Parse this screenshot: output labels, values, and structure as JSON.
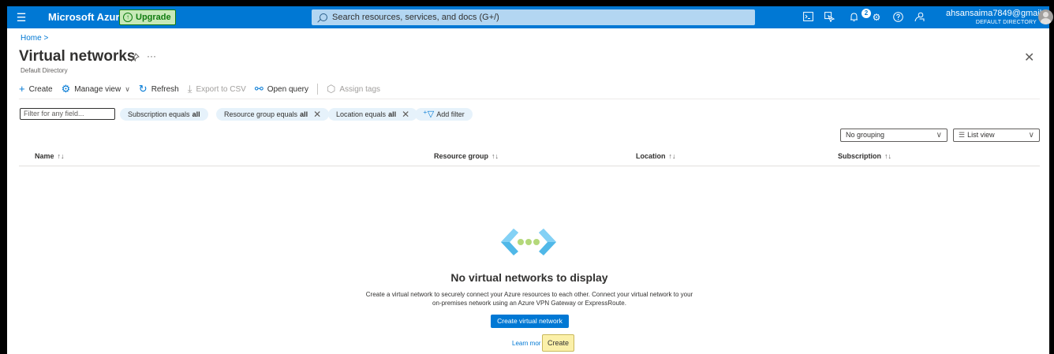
{
  "topbar": {
    "brand": "Microsoft Azure",
    "upgrade_label": "Upgrade",
    "search_placeholder": "Search resources, services, and docs (G+/)",
    "notification_count": "2",
    "user_email": "ahsansaima7849@gmail...",
    "user_directory": "DEFAULT DIRECTORY",
    "icons": [
      "hamburger-menu-icon",
      "cloud-shell-icon",
      "directory-filter-icon",
      "notifications-icon",
      "settings-icon",
      "help-icon",
      "feedback-icon"
    ],
    "accent_color": "#0078d4",
    "upgrade_color": "#c7e9b8"
  },
  "breadcrumb": {
    "home": "Home",
    "separator": ">"
  },
  "page": {
    "title": "Virtual networks",
    "subtitle": "Default Directory"
  },
  "toolbar": {
    "create": "Create",
    "manage_view": "Manage view",
    "refresh": "Refresh",
    "export_csv": "Export to CSV",
    "open_query": "Open query",
    "assign_tags": "Assign tags"
  },
  "filters": {
    "placeholder": "Filter for any field...",
    "pills": [
      {
        "label": "Subscription equals ",
        "value": "all"
      },
      {
        "label": "Resource group equals ",
        "value": "all"
      },
      {
        "label": "Location equals ",
        "value": "all"
      }
    ],
    "add_filter": "Add filter"
  },
  "view_controls": {
    "grouping": "No grouping",
    "view": "List view"
  },
  "table": {
    "columns": [
      "Name",
      "Resource group",
      "Location",
      "Subscription"
    ]
  },
  "empty_state": {
    "title": "No virtual networks to display",
    "description_line1": "Create a virtual network to securely connect your Azure resources to each other. Connect your virtual network to your",
    "description_line2": "on-premises network using an Azure VPN Gateway or ExpressRoute.",
    "button": "Create virtual network",
    "learn_more": "Learn mor",
    "tooltip": "Create"
  }
}
